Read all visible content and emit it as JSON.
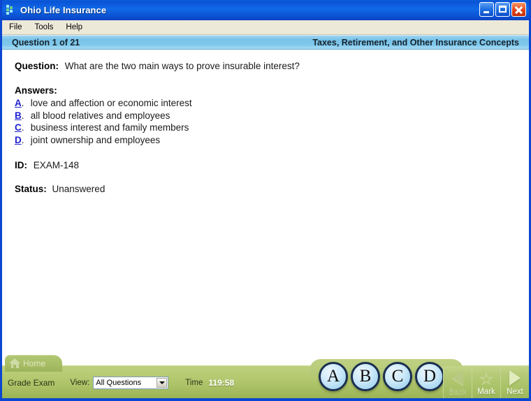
{
  "window": {
    "title": "Ohio Life Insurance",
    "icon": "app-squares-icon",
    "controls": {
      "minimize": "minimize-button",
      "maximize": "maximize-button",
      "close": "close-button"
    }
  },
  "menubar": {
    "items": [
      "File",
      "Tools",
      "Help"
    ]
  },
  "question_header": {
    "counter": "Question 1 of 21",
    "category": "Taxes, Retirement, and Other Insurance Concepts"
  },
  "content": {
    "question_label": "Question:",
    "question_text": "What are the two main ways to prove insurable interest?",
    "answers_label": "Answers:",
    "answers": [
      {
        "key": "A",
        "text": "love and affection or economic interest"
      },
      {
        "key": "B",
        "text": "all blood relatives and employees"
      },
      {
        "key": "C",
        "text": "business interest and family members"
      },
      {
        "key": "D",
        "text": "joint ownership and employees"
      }
    ],
    "id_label": "ID:",
    "id_value": "EXAM-148",
    "status_label": "Status:",
    "status_value": "Unanswered"
  },
  "toolbar": {
    "home_tab": "Home",
    "home_icon": "house-icon",
    "grade_exam": "Grade Exam",
    "view_label": "View:",
    "view_selected": "All Questions",
    "view_options": [
      "All Questions"
    ],
    "time_label": "Time",
    "time_value": "119:58",
    "answer_buttons": [
      "A",
      "B",
      "C",
      "D"
    ],
    "nav": [
      {
        "label": "Back",
        "icon": "triangle-left-icon",
        "enabled": false
      },
      {
        "label": "Mark",
        "icon": "star-icon",
        "enabled": true
      },
      {
        "label": "Next",
        "icon": "triangle-right-icon",
        "enabled": true
      }
    ]
  },
  "colors": {
    "titlebar_blue": "#0a53d6",
    "window_border": "#0a46d0",
    "header_blue": "#79c3e9",
    "toolbar_green": "#aec469",
    "link_blue": "#2020d0",
    "menubar_beige": "#ece9d8"
  }
}
